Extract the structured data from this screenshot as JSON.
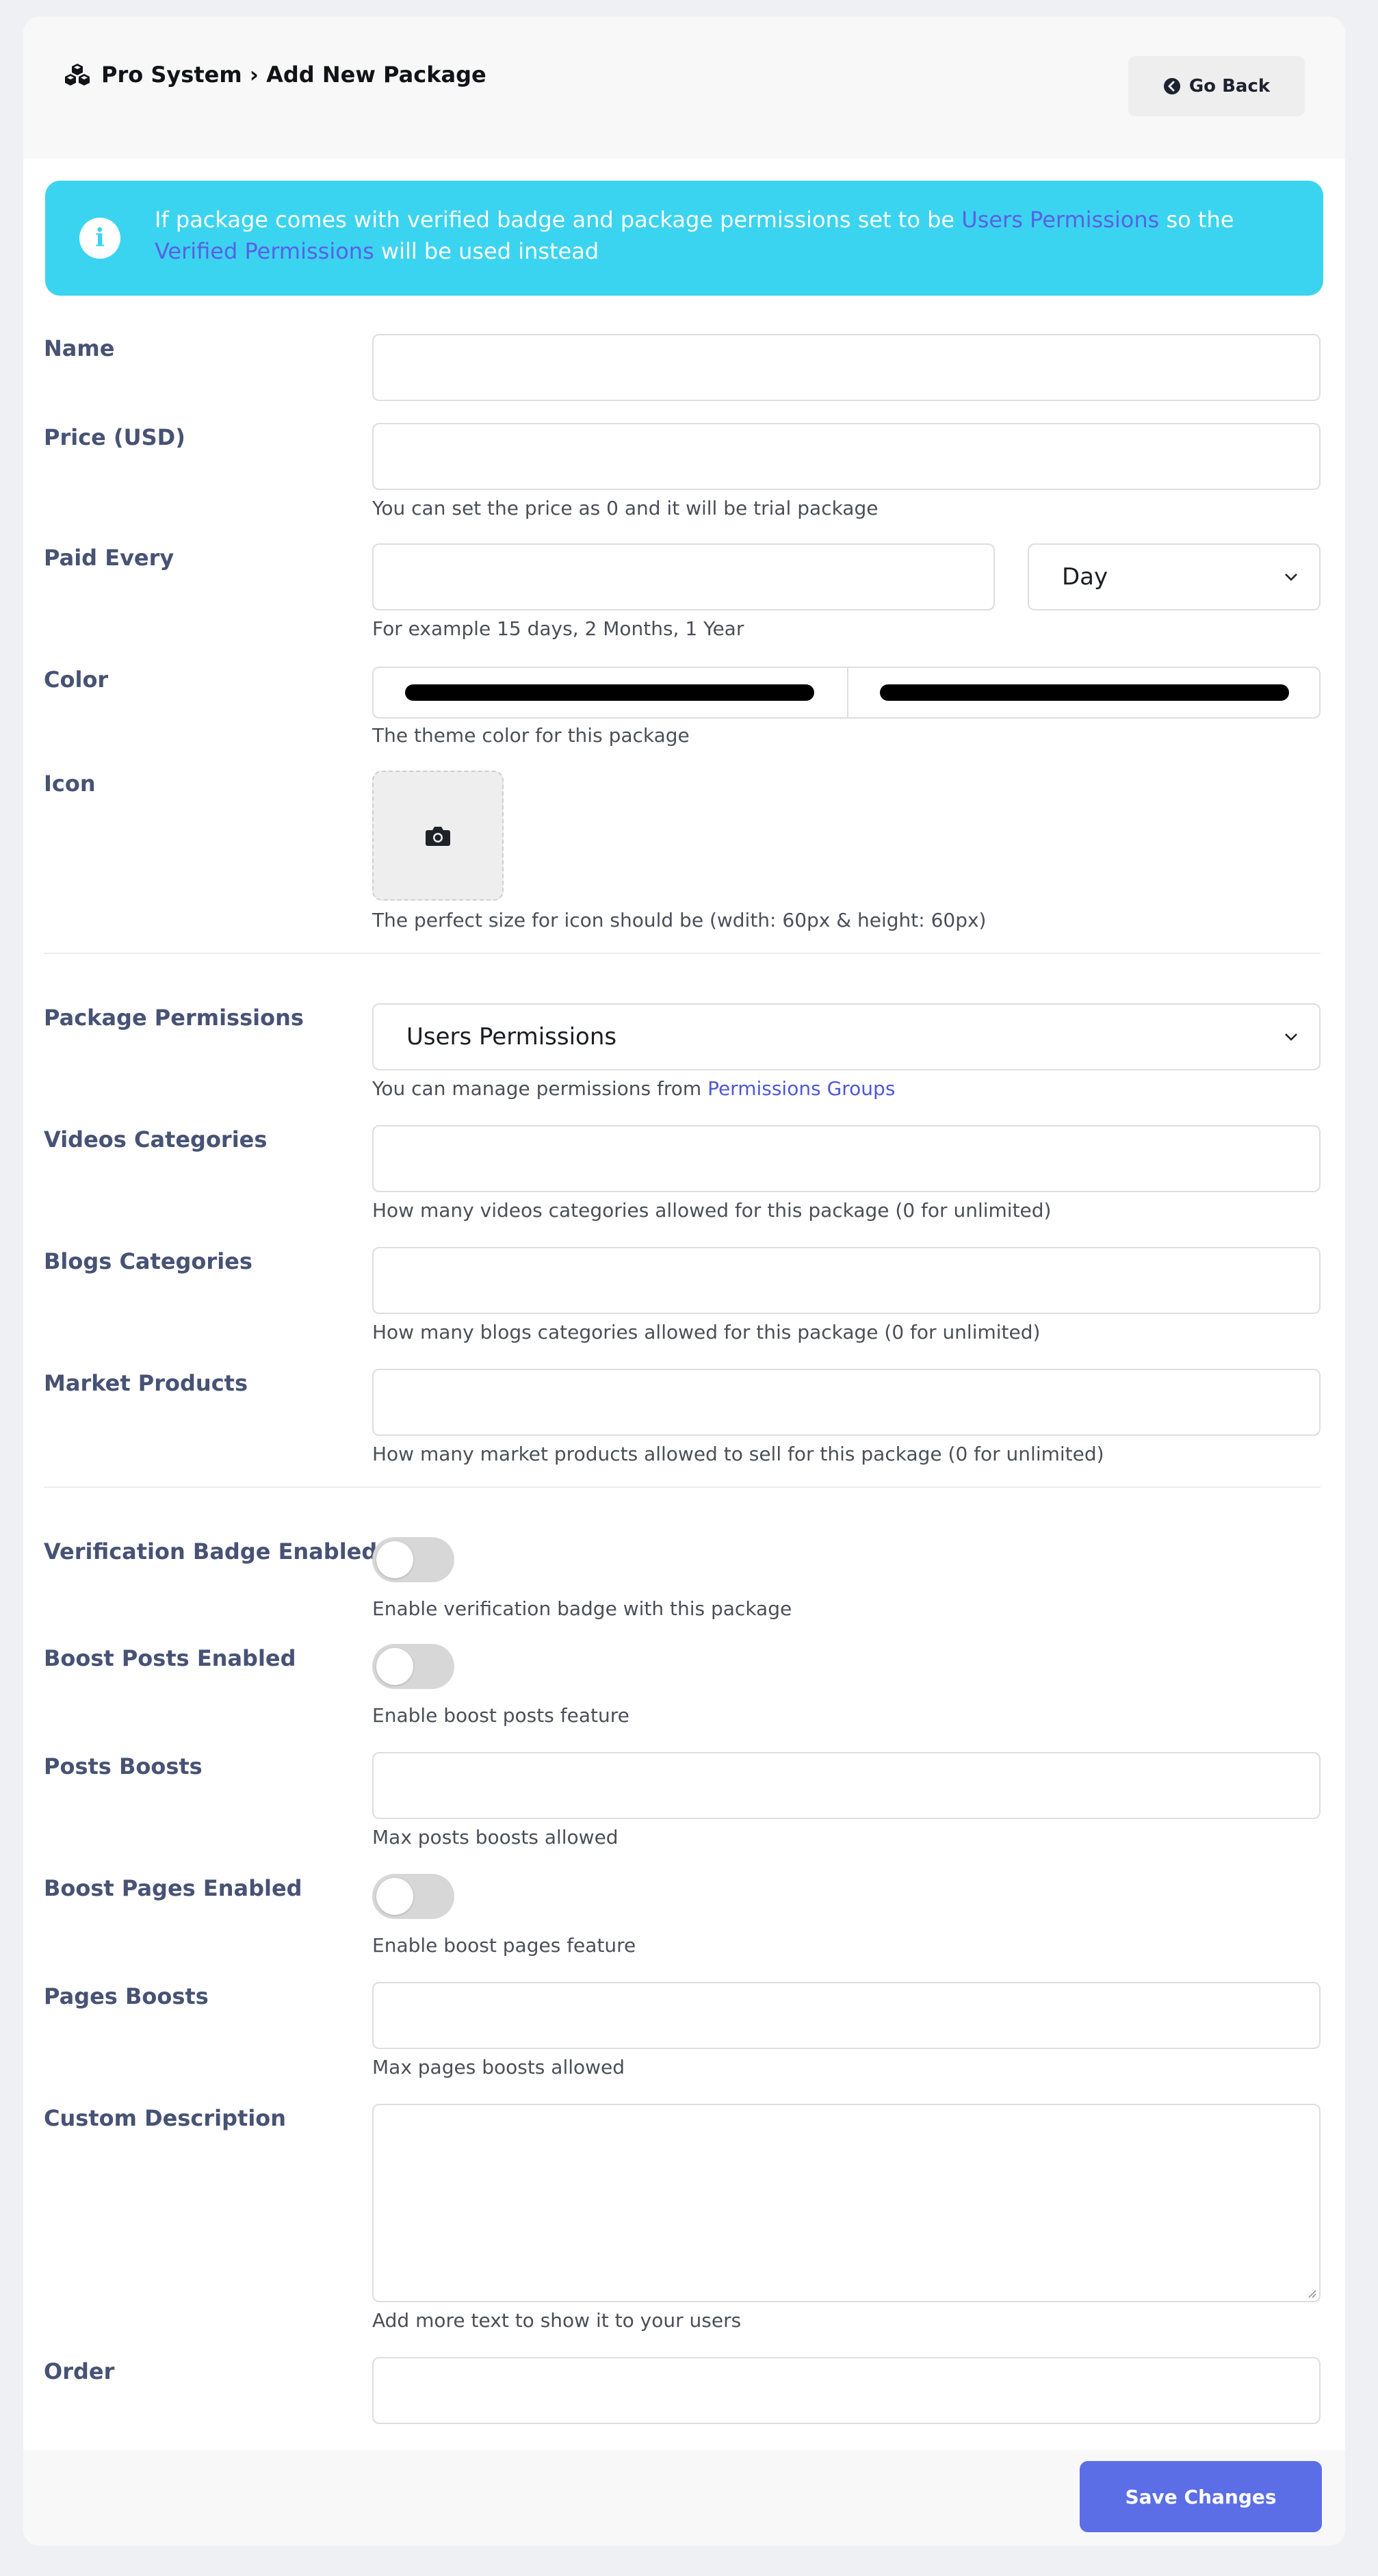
{
  "header": {
    "icon": "cubes-icon",
    "title": "Pro System › Add New Package",
    "back_label": "Go Back",
    "back_icon": "arrow-circle-left-icon"
  },
  "alert": {
    "icon": "info-circle-icon",
    "text_1": "If package comes with verified badge and package permissions set to be ",
    "link_1": "Users Permissions",
    "text_2": " so the ",
    "link_2": "Verified Permissions",
    "text_3": " will be used instead"
  },
  "fields": {
    "name": {
      "label": "Name",
      "value": ""
    },
    "price": {
      "label": "Price (USD)",
      "value": "",
      "hint": "You can set the price as 0 and it will be trial package"
    },
    "paid_every": {
      "label": "Paid Every",
      "value": "",
      "period": "Day",
      "hint": "For example 15 days, 2 Months, 1 Year"
    },
    "color": {
      "label": "Color",
      "color_1": "#000000",
      "color_2": "#000000",
      "hint": "The theme color for this package"
    },
    "icon": {
      "label": "Icon",
      "upload_icon": "camera-icon",
      "hint": "The perfect size for icon should be (wdith: 60px & height: 60px)"
    },
    "package_permissions": {
      "label": "Package Permissions",
      "value": "Users Permissions",
      "hint_text": "You can manage permissions from ",
      "hint_link": "Permissions Groups"
    },
    "videos_categories": {
      "label": "Videos Categories",
      "value": "",
      "hint": "How many videos categories allowed for this package (0 for unlimited)"
    },
    "blogs_categories": {
      "label": "Blogs Categories",
      "value": "",
      "hint": "How many blogs categories allowed for this package (0 for unlimited)"
    },
    "market_products": {
      "label": "Market Products",
      "value": "",
      "hint": "How many market products allowed to sell for this package (0 for unlimited)"
    },
    "verification_badge": {
      "label": "Verification Badge Enabled",
      "enabled": false,
      "hint": "Enable verification badge with this package"
    },
    "boost_posts": {
      "label": "Boost Posts Enabled",
      "enabled": false,
      "hint": "Enable boost posts feature"
    },
    "posts_boosts": {
      "label": "Posts Boosts",
      "value": "",
      "hint": "Max posts boosts allowed"
    },
    "boost_pages": {
      "label": "Boost Pages Enabled",
      "enabled": false,
      "hint": "Enable boost pages feature"
    },
    "pages_boosts": {
      "label": "Pages Boosts",
      "value": "",
      "hint": "Max pages boosts allowed"
    },
    "custom_description": {
      "label": "Custom Description",
      "value": "",
      "hint": "Add more text to show it to your users"
    },
    "order": {
      "label": "Order",
      "value": ""
    }
  },
  "footer": {
    "save_label": "Save Changes"
  },
  "colors": {
    "accent": "#5b6ee6",
    "alert_bg": "#3ad4f0",
    "link": "#4f57d8",
    "label": "#475275"
  }
}
